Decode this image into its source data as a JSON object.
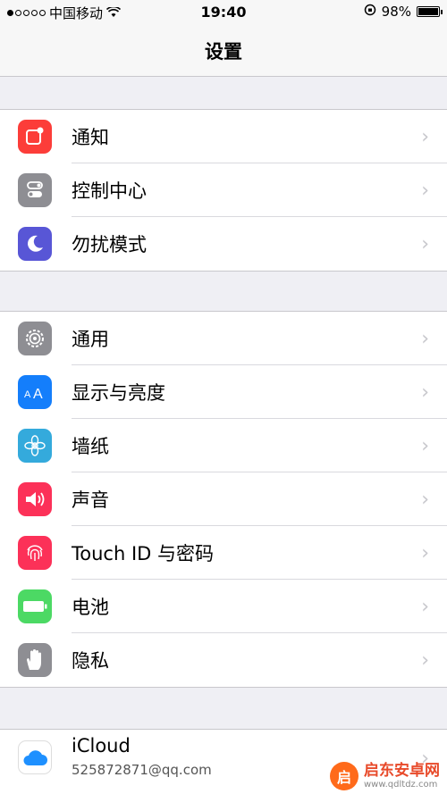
{
  "status_bar": {
    "carrier": "中国移动",
    "time": "19:40",
    "battery": "98%",
    "battery_level": 0.98
  },
  "nav": {
    "title": "设置"
  },
  "group1": [
    {
      "label": "通知",
      "icon": "notifications-icon",
      "color": "#fc3d39"
    },
    {
      "label": "控制中心",
      "icon": "control-center-icon",
      "color": "#8e8e93"
    },
    {
      "label": "勿扰模式",
      "icon": "moon-icon",
      "color": "#5856d6"
    }
  ],
  "group2": [
    {
      "label": "通用",
      "icon": "gear-icon",
      "color": "#8e8e93"
    },
    {
      "label": "显示与亮度",
      "icon": "display-icon",
      "color": "#147efb"
    },
    {
      "label": "墙纸",
      "icon": "wallpaper-icon",
      "color": "#34aadc"
    },
    {
      "label": "声音",
      "icon": "speaker-icon",
      "color": "#fc3158"
    },
    {
      "label": "Touch ID 与密码",
      "icon": "fingerprint-icon",
      "color": "#fc3158"
    },
    {
      "label": "电池",
      "icon": "battery-icon",
      "color": "#4cd964"
    },
    {
      "label": "隐私",
      "icon": "hand-icon",
      "color": "#8e8e93"
    }
  ],
  "icloud": {
    "title": "iCloud",
    "account": "525872871@qq.com",
    "color": "#ffffff"
  },
  "watermark": {
    "name": "启东安卓网",
    "url": "www.qdltdz.com"
  }
}
